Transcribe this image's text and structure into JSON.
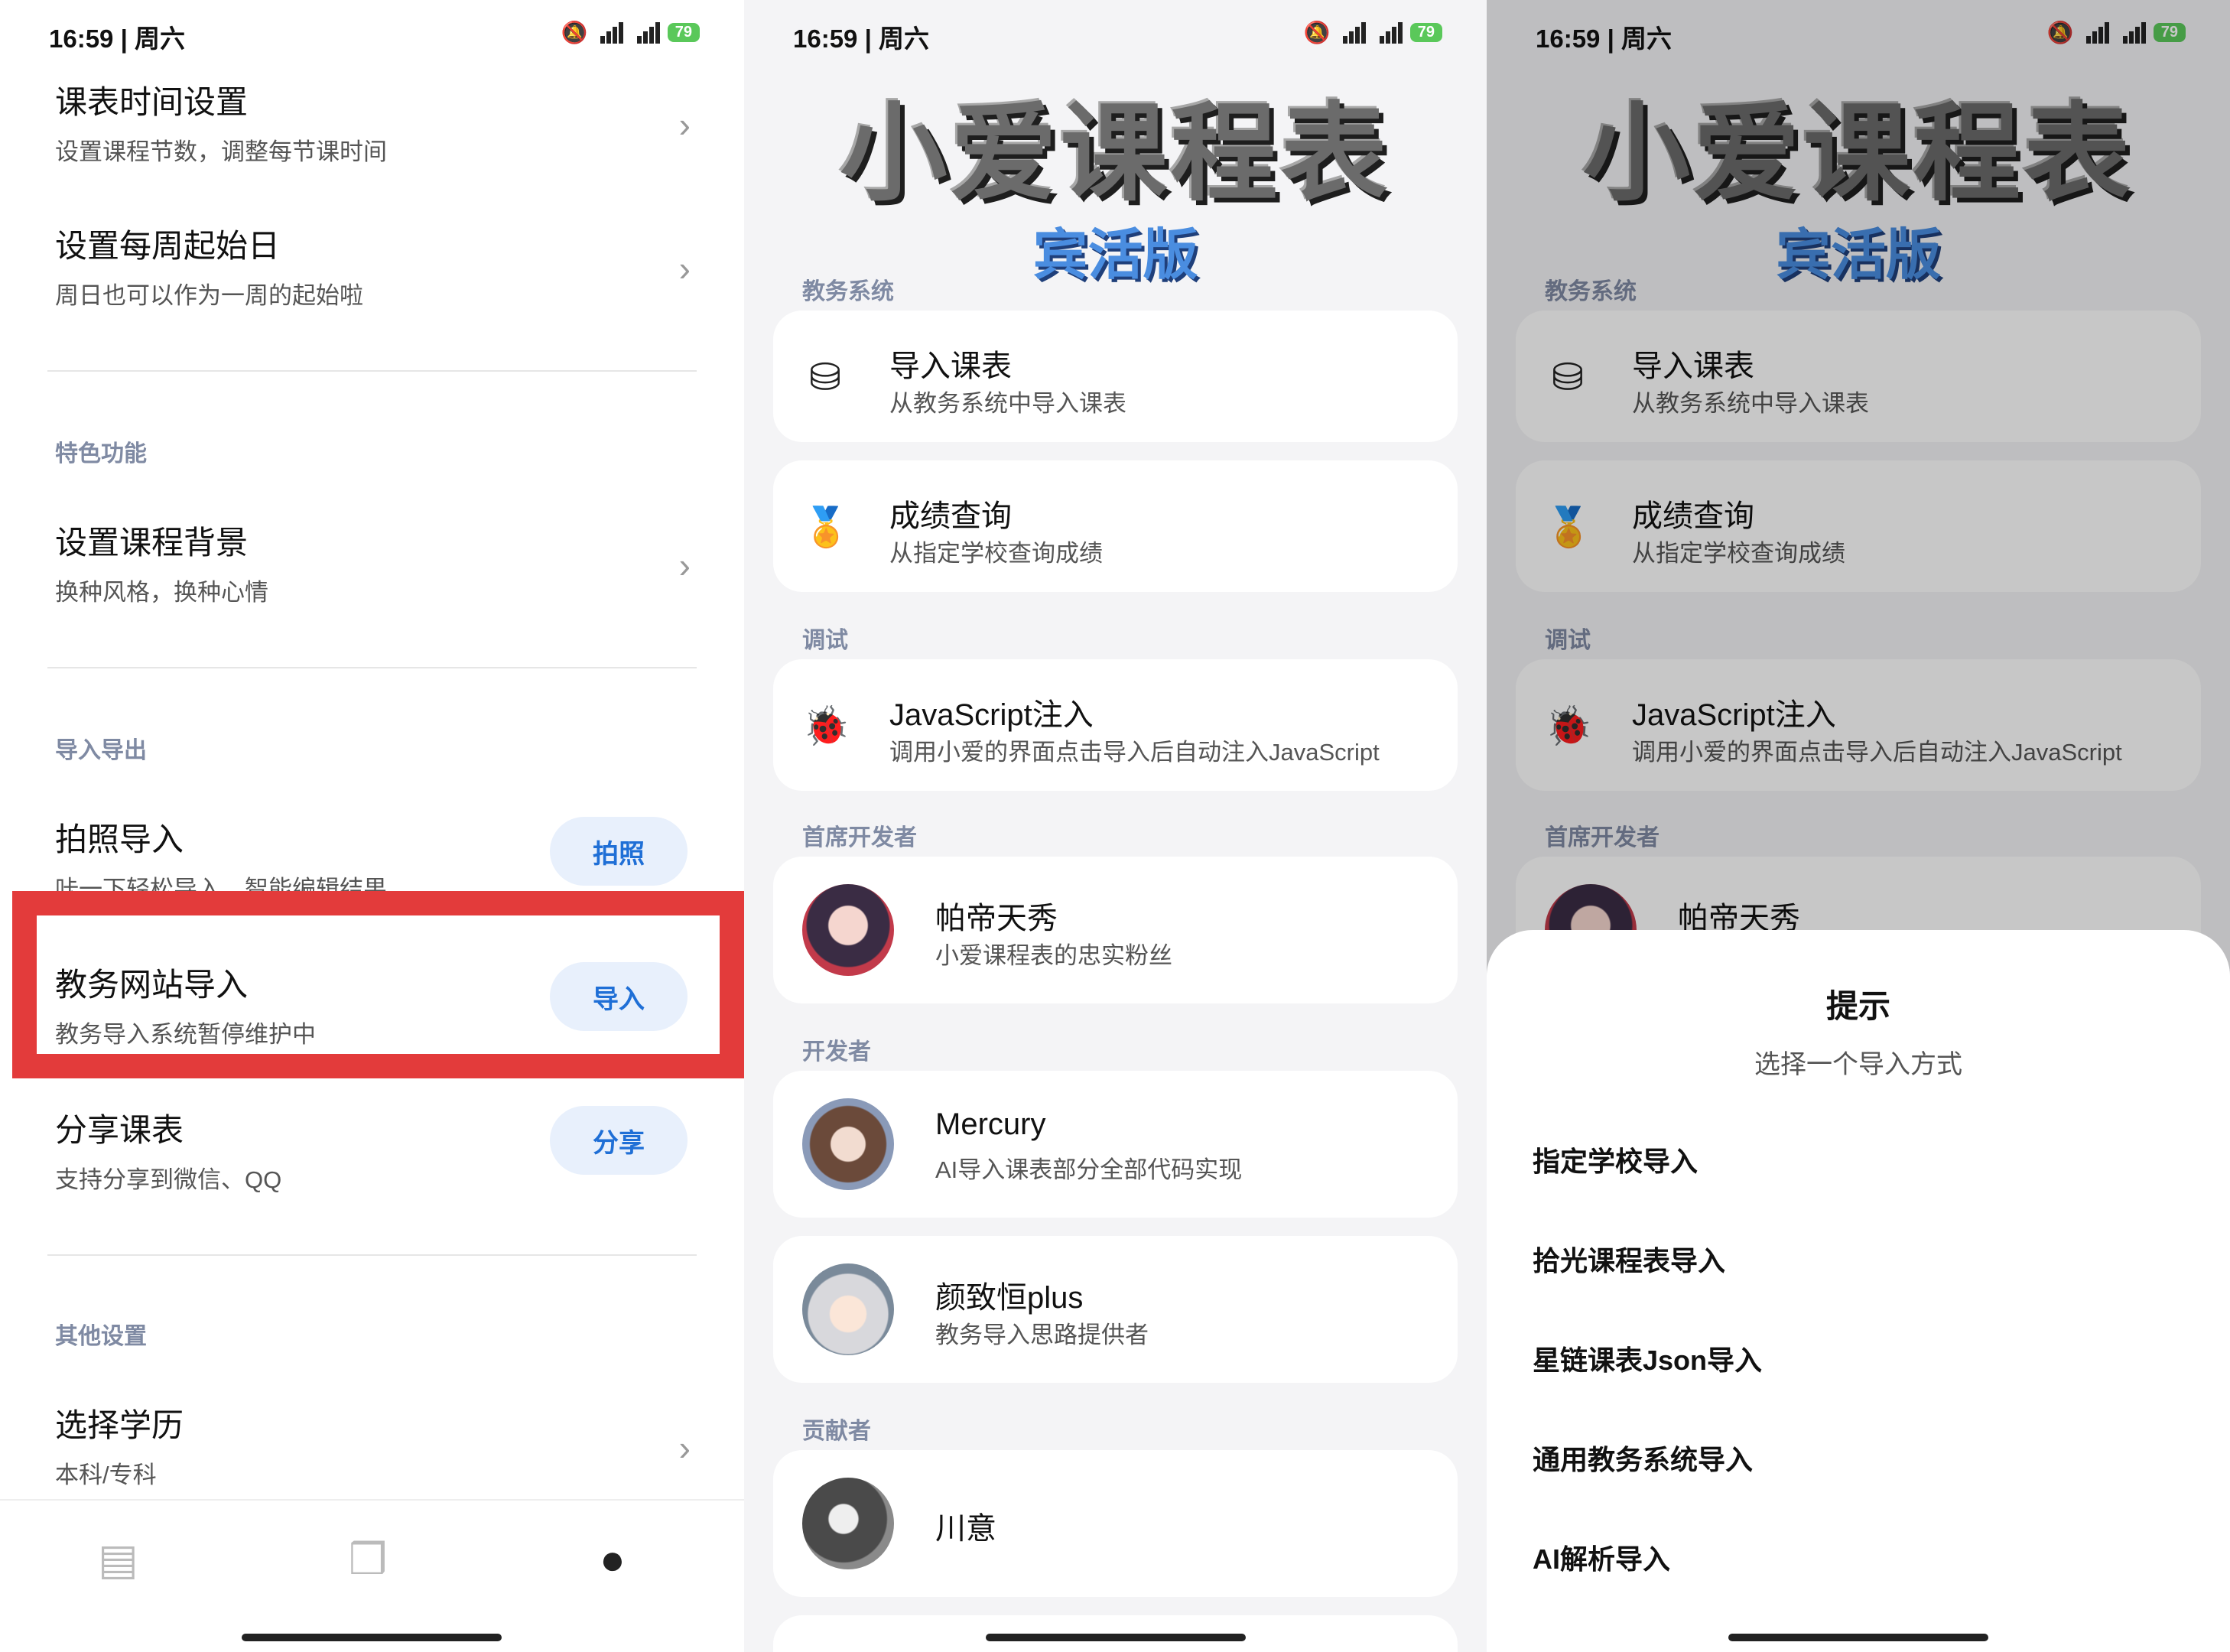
{
  "status": {
    "time": "16:59 | 周六",
    "battery": "79",
    "network": "5G"
  },
  "settings": {
    "row1": {
      "title": "课表时间设置",
      "sub": "设置课程节数，调整每节课时间"
    },
    "row2": {
      "title": "设置每周起始日",
      "sub": "周日也可以作为一周的起始啦"
    },
    "section_features": "特色功能",
    "row3": {
      "title": "设置课程背景",
      "sub": "换种风格，换种心情"
    },
    "section_import": "导入导出",
    "row4": {
      "title": "拍照导入",
      "sub": "咔一下轻松导入，智能编辑结果",
      "button": "拍照"
    },
    "row5": {
      "title": "教务网站导入",
      "sub": "教务导入系统暂停维护中",
      "button": "导入"
    },
    "row6": {
      "title": "分享课表",
      "sub": "支持分享到微信、QQ",
      "button": "分享"
    },
    "section_other": "其他设置",
    "row7": {
      "title": "选择学历",
      "sub": "本科/专科"
    }
  },
  "about": {
    "logo_main": "小爱课程表",
    "logo_sub": "宾活版",
    "group_edu": "教务系统",
    "import": {
      "title": "导入课表",
      "sub": "从教务系统中导入课表"
    },
    "grades": {
      "title": "成绩查询",
      "sub": "从指定学校查询成绩"
    },
    "group_debug": "调试",
    "js": {
      "title": "JavaScript注入",
      "sub": "调用小爱的界面点击导入后自动注入JavaScript"
    },
    "group_chief": "首席开发者",
    "chief": {
      "name": "帕帝天秀",
      "sub": "小爱课程表的忠实粉丝"
    },
    "group_dev": "开发者",
    "dev1": {
      "name": "Mercury",
      "sub": "AI导入课表部分全部代码实现"
    },
    "dev2": {
      "name": "颜致恒plus",
      "sub": "教务导入思路提供者"
    },
    "group_contrib": "贡献者",
    "contrib1": {
      "name": "川意"
    }
  },
  "sheet": {
    "title": "提示",
    "subtitle": "选择一个导入方式",
    "options": [
      "指定学校导入",
      "拾光课程表导入",
      "星链课表Json导入",
      "通用教务系统导入",
      "AI解析导入"
    ]
  }
}
